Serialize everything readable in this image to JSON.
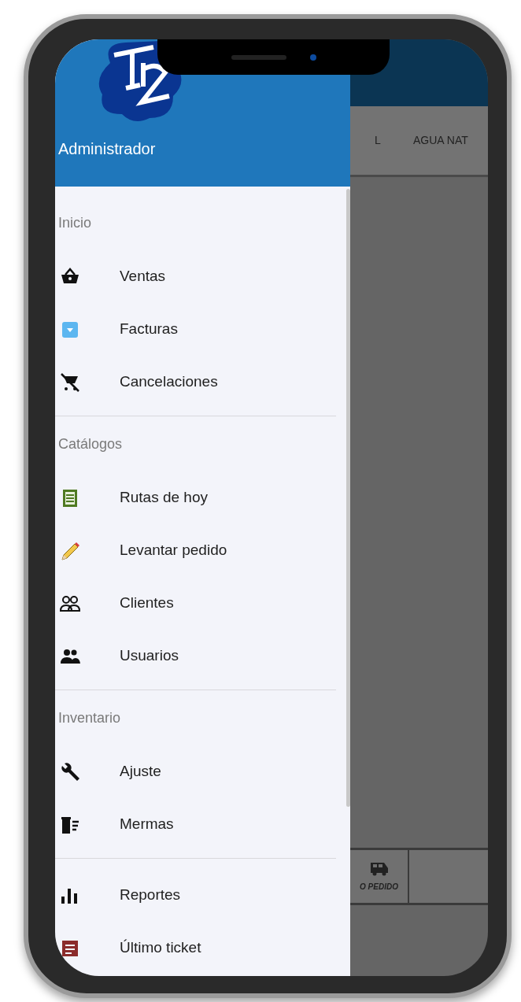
{
  "drawer": {
    "user": "Administrador",
    "sections": [
      {
        "title": "Inicio",
        "items": [
          {
            "label": "Ventas"
          },
          {
            "label": "Facturas"
          },
          {
            "label": "Cancelaciones"
          }
        ]
      },
      {
        "title": "Catálogos",
        "items": [
          {
            "label": "Rutas de hoy"
          },
          {
            "label": "Levantar pedido"
          },
          {
            "label": "Clientes"
          },
          {
            "label": "Usuarios"
          }
        ]
      },
      {
        "title": "Inventario",
        "items": [
          {
            "label": "Ajuste"
          },
          {
            "label": "Mermas"
          }
        ]
      },
      {
        "items": [
          {
            "label": "Reportes"
          },
          {
            "label": "Último ticket"
          }
        ]
      }
    ]
  },
  "background": {
    "columns": [
      "L",
      "AGUA NAT"
    ],
    "bottom_button": "O PEDIDO"
  }
}
